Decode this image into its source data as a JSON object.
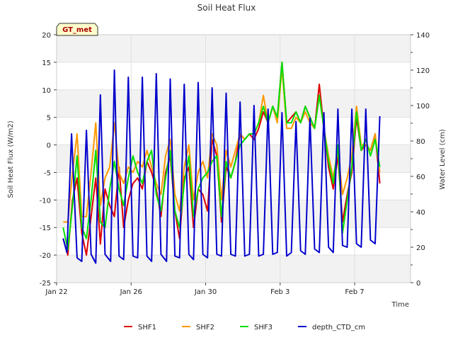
{
  "chart_data": {
    "type": "line",
    "title": "Soil Heat Flux",
    "badge": "GT_met",
    "xlabel": "Time",
    "ylabel": "Soil Heat Flux (W/m2)",
    "y2label": "Water Level (cm)",
    "xlim": [
      0,
      19
    ],
    "ylim": [
      -25,
      20
    ],
    "y2lim": [
      0,
      140
    ],
    "x_ticks": [
      {
        "value": 0,
        "label": "Jan 22"
      },
      {
        "value": 4,
        "label": "Jan 26"
      },
      {
        "value": 8,
        "label": "Jan 30"
      },
      {
        "value": 12,
        "label": "Feb 3"
      },
      {
        "value": 16,
        "label": "Feb 7"
      }
    ],
    "y_ticks": [
      -25,
      -20,
      -15,
      -10,
      -5,
      0,
      5,
      10,
      15,
      20
    ],
    "y2_ticks": [
      0,
      20,
      40,
      60,
      80,
      100,
      120,
      140
    ],
    "grid": true,
    "legend_position": "bottom",
    "series": [
      {
        "name": "SHF1",
        "color": "#dd0000",
        "axis": "left",
        "x": [
          0.35,
          0.6,
          0.85,
          1.1,
          1.35,
          1.6,
          1.85,
          2.1,
          2.35,
          2.6,
          2.85,
          3.1,
          3.35,
          3.6,
          3.85,
          4.1,
          4.35,
          4.6,
          4.85,
          5.1,
          5.35,
          5.6,
          5.85,
          6.1,
          6.35,
          6.6,
          6.85,
          7.1,
          7.35,
          7.6,
          7.85,
          8.1,
          8.35,
          8.6,
          8.85,
          9.1,
          9.35,
          9.6,
          9.85,
          10.1,
          10.35,
          10.6,
          10.85,
          11.1,
          11.35,
          11.6,
          11.85,
          12.1,
          12.35,
          12.6,
          12.85,
          13.1,
          13.35,
          13.6,
          13.85,
          14.1,
          14.35,
          14.6,
          14.85,
          15.1,
          15.35,
          15.6,
          15.85,
          16.1,
          16.35,
          16.6,
          16.85,
          17.1,
          17.35
        ],
        "y": [
          -17,
          -20,
          -10,
          -6,
          -16,
          -20,
          -13,
          -6,
          -18,
          -8,
          -11,
          -13,
          -4,
          -15,
          -10,
          -7,
          -6,
          -8,
          -3,
          -5,
          -8,
          -13,
          -5,
          -2,
          -12,
          -17,
          -6,
          -4,
          -15,
          -8,
          -9,
          -12,
          1,
          -2,
          -14,
          -4,
          -6,
          -3,
          2,
          1,
          2,
          1,
          3,
          6,
          4,
          7,
          5,
          15,
          4,
          5,
          6,
          4,
          7,
          5,
          3,
          11,
          3,
          -4,
          -8,
          -2,
          -14,
          -9,
          -5,
          5,
          -1,
          0,
          -1,
          2,
          -7
        ]
      },
      {
        "name": "SHF2",
        "color": "#ff9900",
        "axis": "left",
        "x": [
          0.35,
          0.6,
          0.85,
          1.1,
          1.35,
          1.6,
          1.85,
          2.1,
          2.35,
          2.6,
          2.85,
          3.1,
          3.35,
          3.6,
          3.85,
          4.1,
          4.35,
          4.6,
          4.85,
          5.1,
          5.35,
          5.6,
          5.85,
          6.1,
          6.35,
          6.6,
          6.85,
          7.1,
          7.35,
          7.6,
          7.85,
          8.1,
          8.35,
          8.6,
          8.85,
          9.1,
          9.35,
          9.6,
          9.85,
          10.1,
          10.35,
          10.6,
          10.85,
          11.1,
          11.35,
          11.6,
          11.85,
          12.1,
          12.35,
          12.6,
          12.85,
          13.1,
          13.35,
          13.6,
          13.85,
          14.1,
          14.35,
          14.6,
          14.85,
          15.1,
          15.35,
          15.6,
          15.85,
          16.1,
          16.35,
          16.6,
          16.85,
          17.1,
          17.35
        ],
        "y": [
          -14,
          -14,
          -5,
          2,
          -13,
          -13,
          -5,
          4,
          -11,
          -6,
          -4,
          4,
          -5,
          -7,
          -4,
          -5,
          -3,
          -4,
          -1,
          -4,
          -7,
          -9,
          -2,
          1,
          -9,
          -12,
          -4,
          0,
          -10,
          -5,
          -3,
          -6,
          2,
          0,
          -10,
          -1,
          -4,
          -1,
          2,
          1,
          2,
          2,
          4,
          9,
          4,
          7,
          4,
          14,
          3,
          3,
          5,
          4,
          6,
          4,
          3,
          9,
          3,
          -2,
          -6,
          -1,
          -9,
          -6,
          -2,
          7,
          0,
          0,
          -1,
          2,
          -5
        ]
      },
      {
        "name": "SHF3",
        "color": "#00e000",
        "axis": "left",
        "x": [
          0.35,
          0.6,
          0.85,
          1.1,
          1.35,
          1.6,
          1.85,
          2.1,
          2.35,
          2.6,
          2.85,
          3.1,
          3.35,
          3.6,
          3.85,
          4.1,
          4.35,
          4.6,
          4.85,
          5.1,
          5.35,
          5.6,
          5.85,
          6.1,
          6.35,
          6.6,
          6.85,
          7.1,
          7.35,
          7.6,
          7.85,
          8.1,
          8.35,
          8.6,
          8.85,
          9.1,
          9.35,
          9.6,
          9.85,
          10.1,
          10.35,
          10.6,
          10.85,
          11.1,
          11.35,
          11.6,
          11.85,
          12.1,
          12.35,
          12.6,
          12.85,
          13.1,
          13.35,
          13.6,
          13.85,
          14.1,
          14.35,
          14.6,
          14.85,
          15.1,
          15.35,
          15.6,
          15.85,
          16.1,
          16.35,
          16.6,
          16.85,
          17.1,
          17.35
        ],
        "y": [
          -15,
          -19,
          -11,
          -2,
          -15,
          -17,
          -10,
          -1,
          -14,
          -15,
          -8,
          -3,
          -8,
          -11,
          -6,
          -2,
          -5,
          -7,
          -3,
          -1,
          -9,
          -12,
          -6,
          -1,
          -12,
          -15,
          -7,
          -2,
          -13,
          -8,
          -6,
          -5,
          -3,
          -2,
          -13,
          -3,
          -6,
          -3,
          0,
          1,
          2,
          2,
          4,
          7,
          4,
          7,
          5,
          15,
          4,
          4,
          6,
          4,
          7,
          5,
          3,
          9,
          3,
          -3,
          -7,
          0,
          -16,
          -10,
          -4,
          6,
          -1,
          1,
          -2,
          1,
          -4
        ]
      },
      {
        "name": "depth_CTD_cm",
        "color": "#0000cc",
        "axis": "right",
        "x": [
          0.35,
          0.55,
          0.8,
          1.1,
          1.35,
          1.6,
          1.85,
          2.1,
          2.35,
          2.6,
          2.9,
          3.1,
          3.35,
          3.6,
          3.85,
          4.1,
          4.35,
          4.6,
          4.85,
          5.1,
          5.35,
          5.6,
          5.9,
          6.1,
          6.35,
          6.6,
          6.85,
          7.1,
          7.35,
          7.6,
          7.85,
          8.1,
          8.35,
          8.6,
          8.85,
          9.1,
          9.35,
          9.6,
          9.85,
          10.1,
          10.35,
          10.6,
          10.85,
          11.1,
          11.35,
          11.6,
          11.85,
          12.1,
          12.35,
          12.6,
          12.85,
          13.1,
          13.35,
          13.6,
          13.85,
          14.1,
          14.35,
          14.6,
          14.85,
          15.1,
          15.35,
          15.6,
          15.85,
          16.1,
          16.35,
          16.6,
          16.85,
          17.1,
          17.35
        ],
        "y": [
          25,
          17,
          84,
          14,
          12,
          86,
          16,
          11,
          106,
          16,
          12,
          120,
          15,
          13,
          116,
          15,
          14,
          116,
          15,
          12,
          118,
          16,
          12,
          115,
          15,
          14,
          112,
          16,
          13,
          113,
          16,
          14,
          110,
          16,
          15,
          107,
          16,
          15,
          102,
          15,
          16,
          100,
          15,
          16,
          98,
          16,
          17,
          96,
          15,
          17,
          91,
          18,
          16,
          93,
          19,
          17,
          96,
          20,
          17,
          98,
          21,
          20,
          98,
          22,
          20,
          98,
          24,
          22,
          94
        ]
      }
    ]
  }
}
